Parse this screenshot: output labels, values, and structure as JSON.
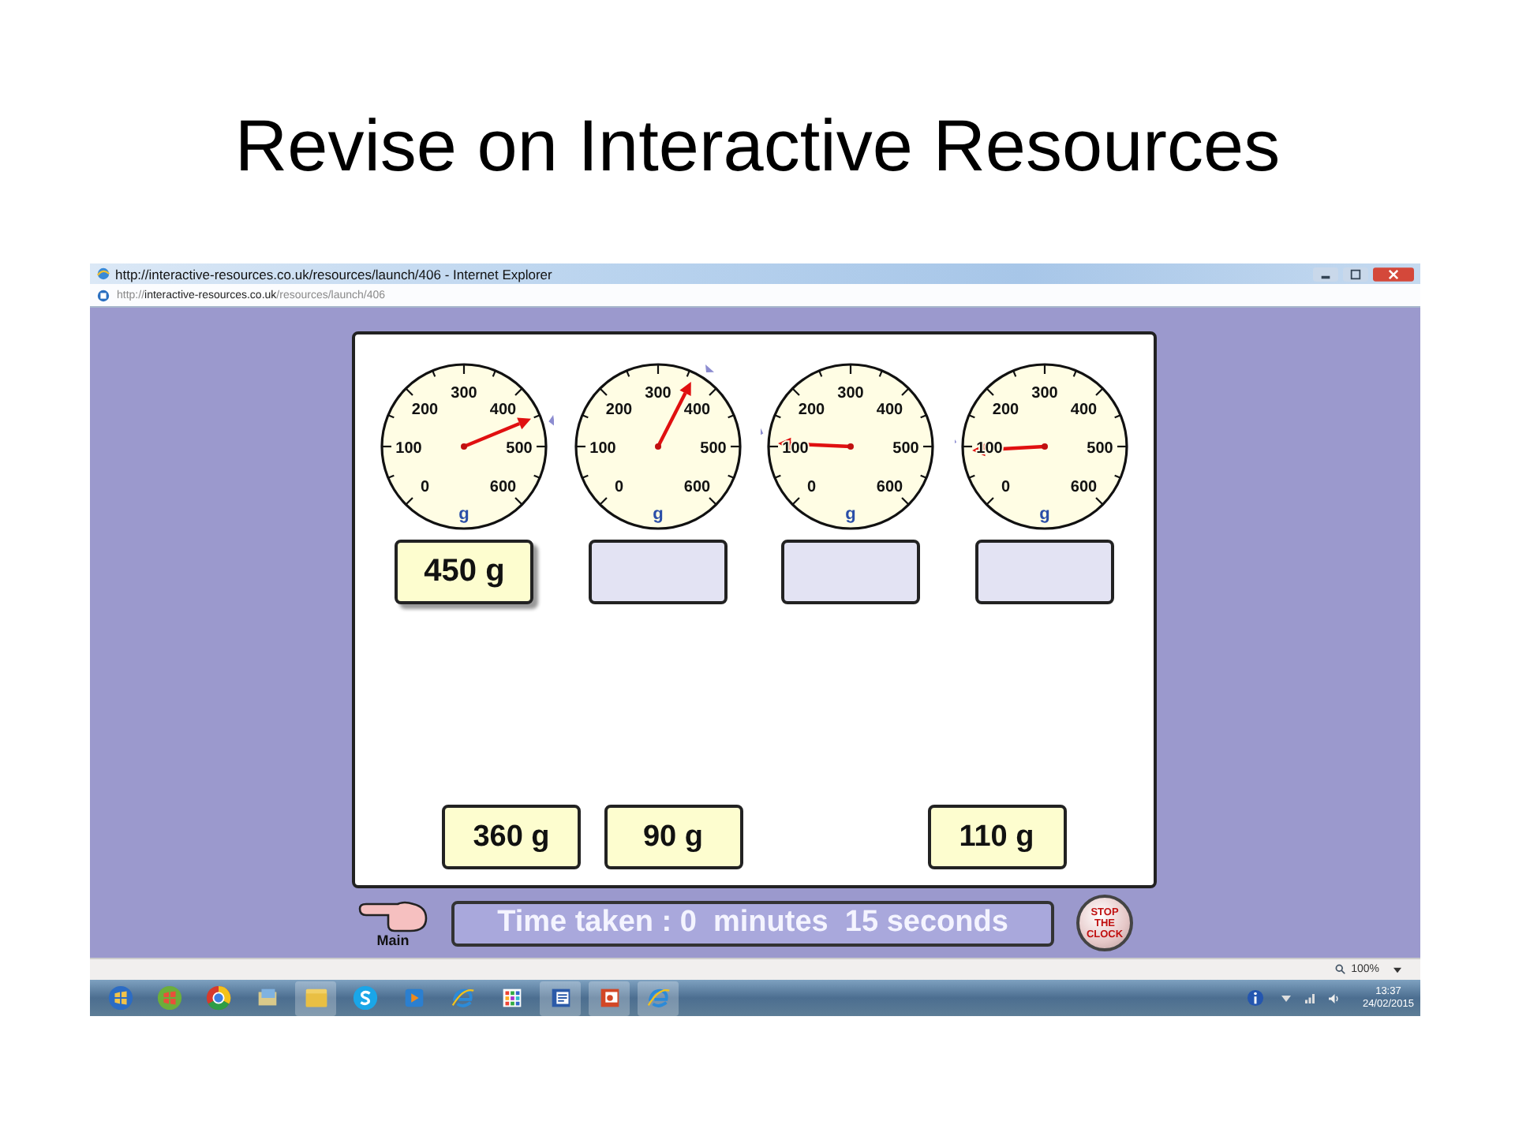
{
  "slide": {
    "title": "Revise on Interactive Resources"
  },
  "window": {
    "title": "http://interactive-resources.co.uk/resources/launch/406 - Internet Explorer",
    "address": "http://**interactive-resources.co.uk**/resources/launch/406"
  },
  "dials": [
    {
      "level": 0.75,
      "scale": [
        "0",
        "100",
        "200",
        "300",
        "400",
        "500",
        "600"
      ],
      "unit": "g",
      "answer": "450 g"
    },
    {
      "level": 0.6,
      "scale": [
        "0",
        "100",
        "200",
        "300",
        "400",
        "500",
        "600"
      ],
      "unit": "g"
    },
    {
      "level": 0.176,
      "scale": [
        "0",
        "100",
        "200",
        "300",
        "400",
        "500",
        "600"
      ],
      "unit": "g"
    },
    {
      "level": 0.155,
      "scale": [
        "0",
        "100",
        "200",
        "300",
        "400",
        "500",
        "600"
      ],
      "unit": "g"
    }
  ],
  "tray": [
    {
      "kind": "card",
      "label": "360 g"
    },
    {
      "kind": "card",
      "label": "90 g"
    },
    {
      "kind": "empty"
    },
    {
      "kind": "card",
      "label": "110 g"
    }
  ],
  "footer": {
    "main_label": "Main",
    "timer": "Time taken : 0  minutes  15 seconds",
    "stop_button": "STOP THE CLOCK"
  },
  "status_bar": {
    "zoom": "100%"
  },
  "taskbar": {
    "time": "13:37",
    "date": "24/02/2015"
  }
}
